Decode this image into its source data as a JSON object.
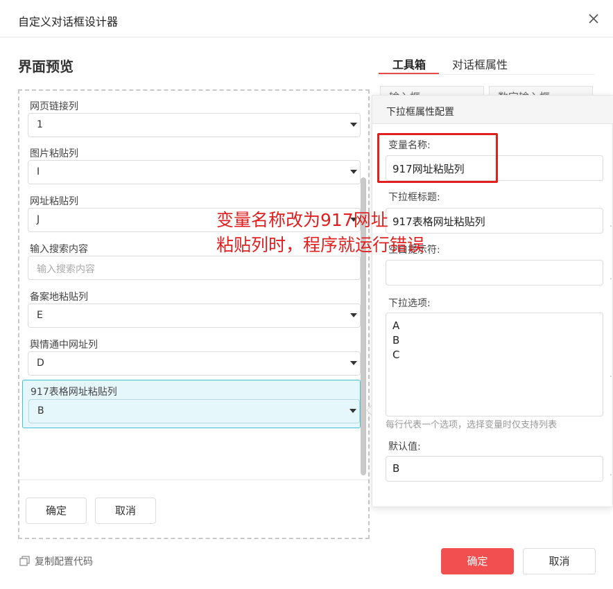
{
  "dialog": {
    "title": "自定义对话框设计器"
  },
  "preview": {
    "section_title": "界面预览",
    "fields": [
      {
        "label": "网页链接列",
        "value": "1",
        "type": "select"
      },
      {
        "label": "图片粘贴列",
        "value": "I",
        "type": "select"
      },
      {
        "label": "网址粘贴列",
        "value": "J",
        "type": "select"
      },
      {
        "label": "输入搜索内容",
        "placeholder": "输入搜索内容",
        "type": "input"
      },
      {
        "label": "备案地粘贴列",
        "value": "E",
        "type": "select"
      },
      {
        "label": "舆情通中网址列",
        "value": "D",
        "type": "select"
      },
      {
        "label": "917表格网址粘贴列",
        "value": "B",
        "type": "select"
      }
    ],
    "ok_label": "确定",
    "cancel_label": "取消"
  },
  "tabs": {
    "toolbox": "工具箱",
    "dialog_props": "对话框属性"
  },
  "toolbox_items": [
    "输入框",
    "数字输入框"
  ],
  "popover": {
    "title": "下拉框属性配置",
    "var_name_label": "变量名称:",
    "var_name_value": "917网址粘贴列",
    "select_title_label": "下拉框标题:",
    "select_title_value": "917表格网址粘贴列",
    "placeholder_label": "空白提示符:",
    "placeholder_value": "",
    "options_label": "下拉选项:",
    "options": [
      "A",
      "B",
      "C"
    ],
    "options_hint": "每行代表一个选项，选择变量时仅支持列表",
    "default_label": "默认值:",
    "default_value": "B"
  },
  "footer": {
    "copy_label": "复制配置代码",
    "ok_label": "确定",
    "cancel_label": "取消"
  },
  "annotation": {
    "line1": "变量名称改为917网址",
    "line2": "粘贴列时，程序就运行错误"
  },
  "colors": {
    "primary": "#f25050",
    "annotation": "#e02020",
    "selected_border": "#3fc1d6"
  }
}
